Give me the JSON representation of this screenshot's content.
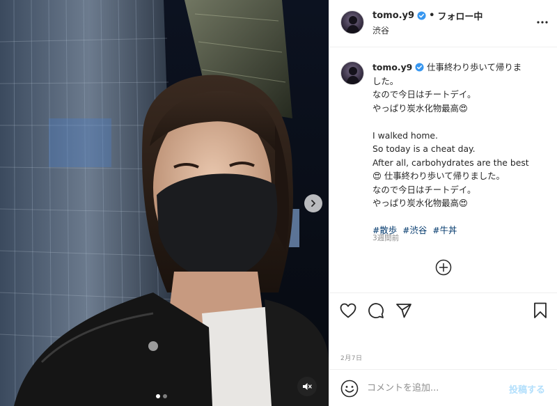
{
  "post": {
    "username": "tomo.y9",
    "verified": true,
    "separator": "•",
    "follow_status": "フォロー中",
    "location": "渋谷"
  },
  "caption": {
    "username": "tomo.y9",
    "lines": [
      "仕事終わり歩いて帰りま",
      "した。",
      "なので今日はチートデイ。",
      "やっぱり炭水化物最高😍",
      "",
      "I walked home.",
      "So today is a cheat day.",
      "After all, carbohydrates are the best",
      "😍 仕事終わり歩いて帰りました。",
      "なので今日はチートデイ。",
      "やっぱり炭水化物最高😍"
    ],
    "hashtags": [
      "#散歩",
      "#渋谷",
      "#牛丼"
    ],
    "time_ago": "3週間前"
  },
  "footer": {
    "date": "2月7日",
    "comment_placeholder": "コメントを追加...",
    "post_label": "投稿する"
  },
  "media": {
    "slide_count": 2,
    "active_slide": 1
  },
  "icons": {
    "more": "more-options-icon",
    "like": "heart-icon",
    "comment": "comment-icon",
    "share": "share-icon",
    "save": "bookmark-icon",
    "add": "add-circle-icon",
    "emoji": "emoji-icon",
    "next": "chevron-right-icon",
    "sound": "speaker-muted-icon"
  },
  "colors": {
    "verified": "#3897f0",
    "link": "#00376b",
    "post_button": "#b2dffc",
    "muted_text": "#8e8e8e"
  }
}
